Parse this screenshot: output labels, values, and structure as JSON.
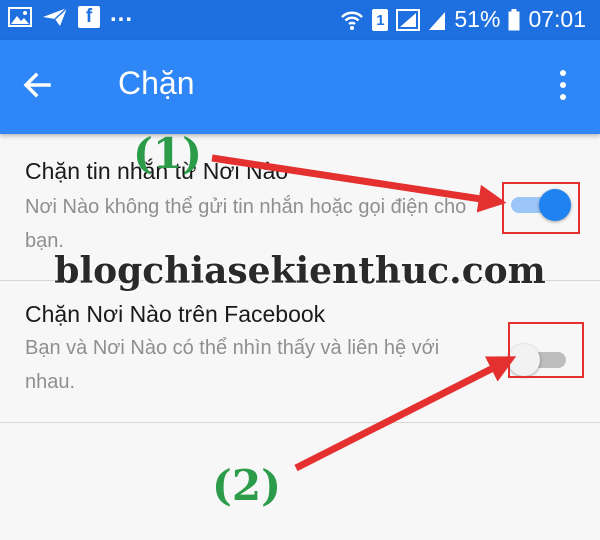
{
  "status_bar": {
    "notification_icons": [
      "image-icon",
      "send-icon",
      "facebook-icon"
    ],
    "facebook_letter": "f",
    "overflow": "...",
    "sim_label": "1",
    "battery_percent": "51%",
    "time": "07:01"
  },
  "app_bar": {
    "title": "Chặn",
    "back_icon": "arrow-left-icon",
    "menu_icon": "more-vertical-icon"
  },
  "settings": [
    {
      "title": "Chặn tin nhắn từ Nơi Nào",
      "subtitle": "Nơi Nào không thể gửi tin nhắn hoặc gọi điện cho bạn.",
      "enabled": true
    },
    {
      "title": "Chặn Nơi Nào trên Facebook",
      "subtitle": "Bạn và Nơi Nào có thể nhìn thấy và liên hệ với nhau.",
      "enabled": false
    }
  ],
  "annotations": {
    "label_1": "(1)",
    "label_2": "(2)",
    "watermark": "blogchiasekienthuc.com"
  },
  "colors": {
    "status_bar": "#1e6fe0",
    "app_bar": "#2f86f6",
    "switch_on": "#1e82f0",
    "highlight": "#e53030",
    "label_green": "#2c9c4a"
  }
}
